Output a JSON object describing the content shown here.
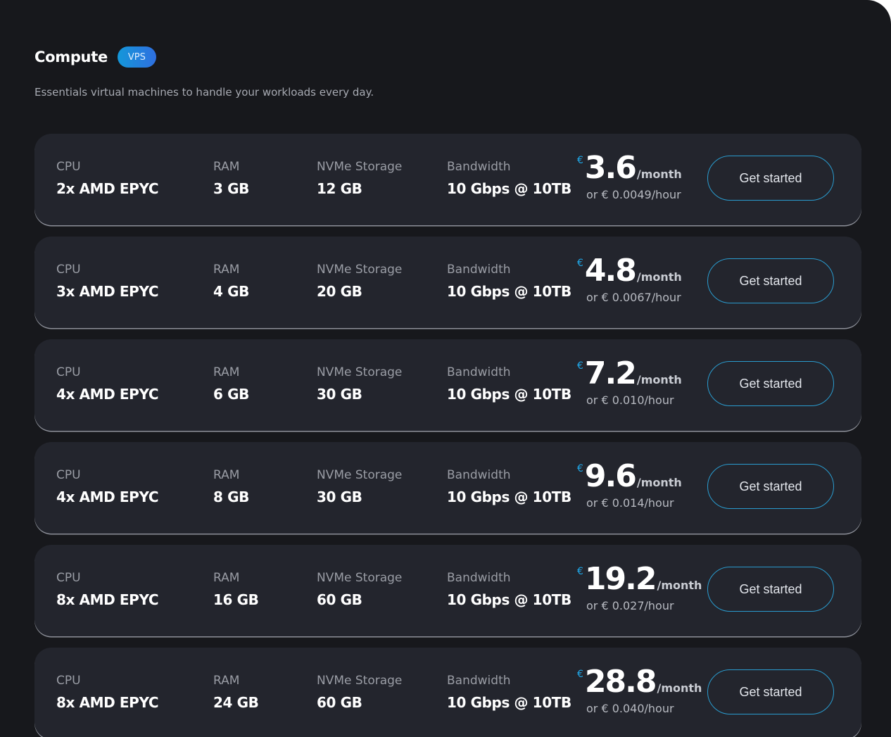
{
  "header": {
    "title": "Compute",
    "badge": "VPS",
    "subtitle": "Essentials virtual machines to handle your workloads every day."
  },
  "labels": {
    "cpu": "CPU",
    "ram": "RAM",
    "storage": "NVMe Storage",
    "bandwidth": "Bandwidth",
    "currency": "€",
    "per_month": "/month",
    "cta": "Get started"
  },
  "plans": [
    {
      "cpu": "2x AMD EPYC",
      "ram": "3 GB",
      "storage": "12 GB",
      "bandwidth": "10 Gbps @ 10TB",
      "price": "3.6",
      "hourly": "or € 0.0049/hour"
    },
    {
      "cpu": "3x AMD EPYC",
      "ram": "4 GB",
      "storage": "20 GB",
      "bandwidth": "10 Gbps @ 10TB",
      "price": "4.8",
      "hourly": "or € 0.0067/hour"
    },
    {
      "cpu": "4x AMD EPYC",
      "ram": "6 GB",
      "storage": "30 GB",
      "bandwidth": "10 Gbps @ 10TB",
      "price": "7.2",
      "hourly": "or € 0.010/hour"
    },
    {
      "cpu": "4x AMD EPYC",
      "ram": "8 GB",
      "storage": "30 GB",
      "bandwidth": "10 Gbps @ 10TB",
      "price": "9.6",
      "hourly": "or € 0.014/hour"
    },
    {
      "cpu": "8x AMD EPYC",
      "ram": "16 GB",
      "storage": "60 GB",
      "bandwidth": "10 Gbps @ 10TB",
      "price": "19.2",
      "hourly": "or € 0.027/hour"
    },
    {
      "cpu": "8x AMD EPYC",
      "ram": "24 GB",
      "storage": "60 GB",
      "bandwidth": "10 Gbps @ 10TB",
      "price": "28.8",
      "hourly": "or € 0.040/hour"
    }
  ],
  "colors": {
    "background": "#17181c",
    "card": "#23252d",
    "accent": "#1fa6e6",
    "button_border": "#2a9ccf"
  }
}
